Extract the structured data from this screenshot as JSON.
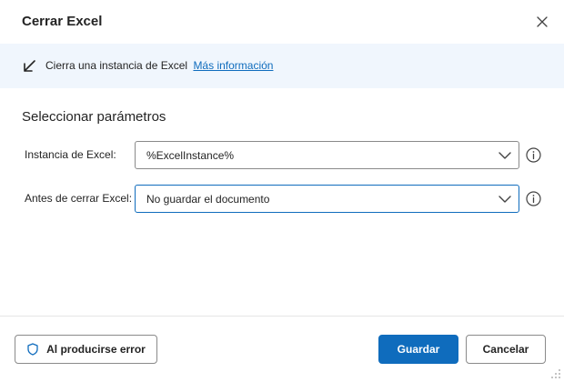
{
  "dialog": {
    "title": "Cerrar Excel",
    "close_icon": "close-icon"
  },
  "info": {
    "icon": "arrow-down-left-icon",
    "text": "Cierra una instancia de Excel",
    "link": "Más información"
  },
  "section": {
    "title": "Seleccionar parámetros"
  },
  "fields": [
    {
      "label": "Instancia de Excel:",
      "value": "%ExcelInstance%",
      "icon": "chevron-down-icon",
      "help_icon": "info-icon"
    },
    {
      "label": "Antes de cerrar Excel:",
      "value": "No guardar el documento",
      "icon": "chevron-down-icon",
      "help_icon": "info-icon"
    }
  ],
  "footer": {
    "on_error_label": "Al producirse error",
    "on_error_icon": "shield-icon",
    "save_label": "Guardar",
    "cancel_label": "Cancelar"
  },
  "colors": {
    "accent": "#0f6cbd",
    "info_bar_bg": "#f0f6fd",
    "border": "#8a8a8a"
  }
}
